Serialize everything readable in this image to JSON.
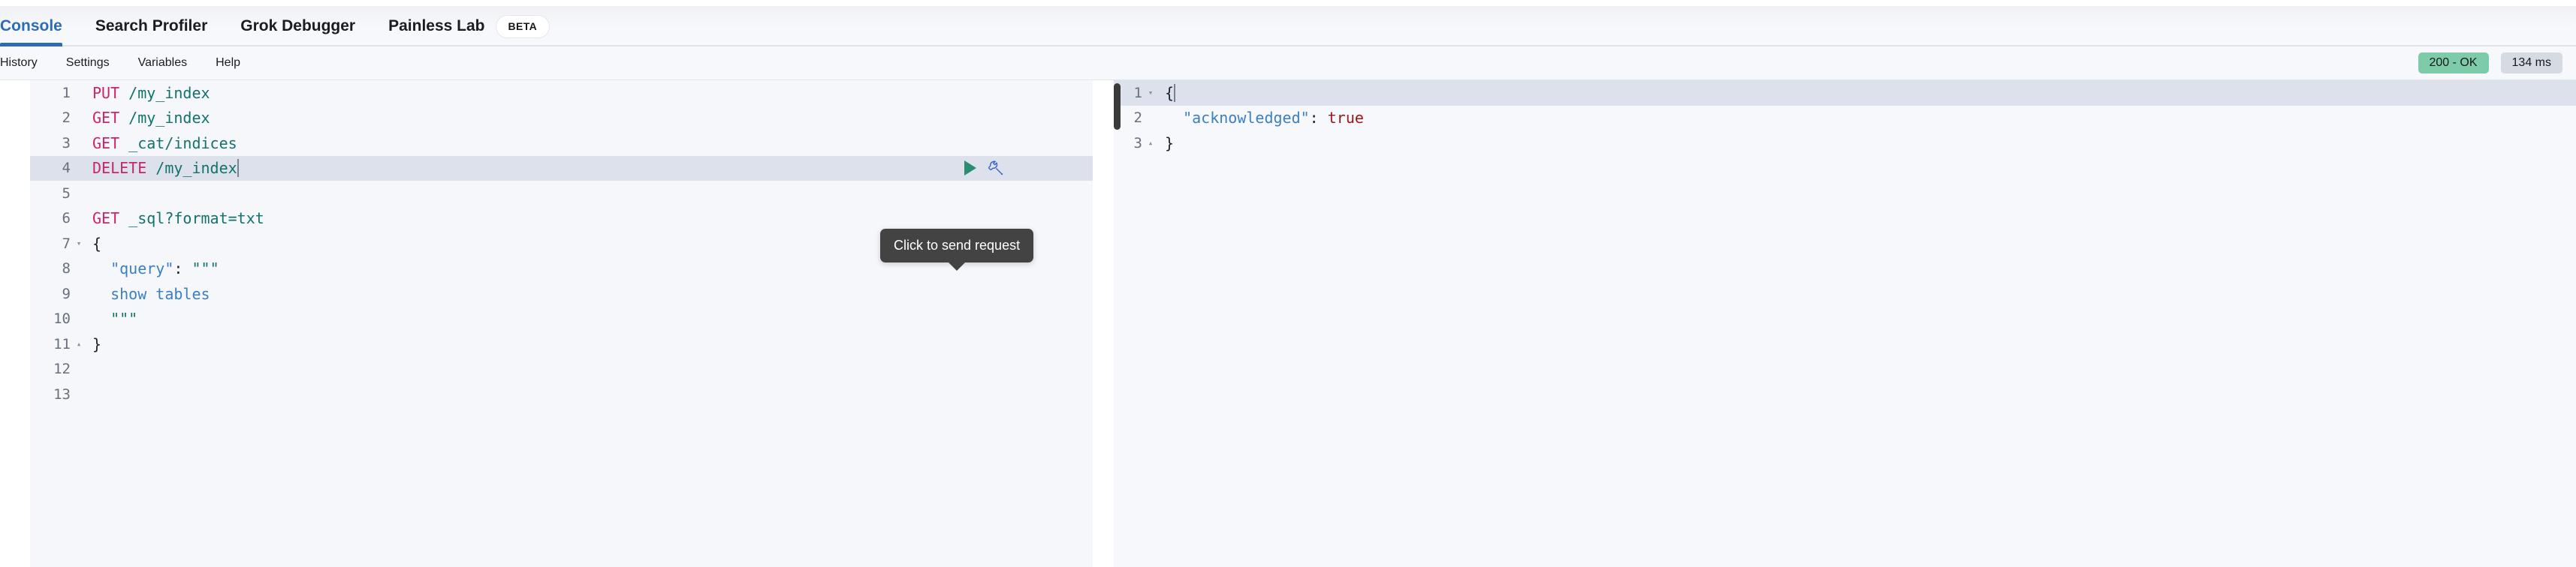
{
  "tabs": [
    {
      "label": "Console",
      "active": true,
      "badge": null
    },
    {
      "label": "Search Profiler",
      "active": false,
      "badge": null
    },
    {
      "label": "Grok Debugger",
      "active": false,
      "badge": null
    },
    {
      "label": "Painless Lab",
      "active": false,
      "badge": "BETA"
    }
  ],
  "submenu": {
    "items": [
      {
        "label": "History"
      },
      {
        "label": "Settings"
      },
      {
        "label": "Variables"
      },
      {
        "label": "Help"
      }
    ],
    "status": {
      "code_label": "200 - OK",
      "time_label": "134 ms",
      "ok_color": "#7DCBA8",
      "time_color": "#D6DAE3"
    }
  },
  "editor": {
    "tooltip": "Click to send request",
    "active_line": 4,
    "lines": [
      {
        "num": "1",
        "fold": "",
        "method": "PUT",
        "url": "/my_index",
        "active": false
      },
      {
        "num": "2",
        "fold": "",
        "method": "GET",
        "url": "/my_index",
        "active": false
      },
      {
        "num": "3",
        "fold": "",
        "method": "GET",
        "url": "_cat/indices",
        "active": false
      },
      {
        "num": "4",
        "fold": "",
        "method": "DELETE",
        "url": "/my_index",
        "active": true,
        "caret": true
      },
      {
        "num": "5",
        "fold": "",
        "text": "",
        "active": false
      },
      {
        "num": "6",
        "fold": "",
        "method": "GET",
        "url": "_sql?format=txt",
        "active": false
      },
      {
        "num": "7",
        "fold": "▾",
        "punct": "{",
        "active": false
      },
      {
        "num": "8",
        "fold": "",
        "key": "\"query\"",
        "colon": ": ",
        "string": "\"\"\"",
        "indent": "  ",
        "active": false
      },
      {
        "num": "9",
        "fold": "",
        "sql": "show tables",
        "indent": "  ",
        "active": false
      },
      {
        "num": "10",
        "fold": "",
        "string": "\"\"\"",
        "indent": "  ",
        "active": false
      },
      {
        "num": "11",
        "fold": "▴",
        "punct": "}",
        "active": false
      },
      {
        "num": "12",
        "fold": "",
        "text": "",
        "active": false
      },
      {
        "num": "13",
        "fold": "",
        "text": "",
        "active": false
      }
    ],
    "icons": {
      "play": "play-triangle-icon",
      "wrench": "wrench-icon"
    },
    "colors": {
      "method": "#C9256B",
      "url": "#14716B",
      "key": "#3A7FC4",
      "string": "#14716B",
      "active_line_bg": "#DCE1EB",
      "play": "#2E8B74",
      "wrench": "#3A63C4"
    }
  },
  "response": {
    "lines": [
      {
        "num": "1",
        "fold": "▾",
        "punct": "{",
        "active": true,
        "caret": true
      },
      {
        "num": "2",
        "fold": "",
        "key": "\"acknowledged\"",
        "colon": ": ",
        "bool": "true",
        "indent": "  ",
        "active": false
      },
      {
        "num": "3",
        "fold": "▴",
        "punct": "}",
        "active": false
      }
    ],
    "colors": {
      "key": "#3A7FC4",
      "bool": "#9E1717"
    }
  }
}
